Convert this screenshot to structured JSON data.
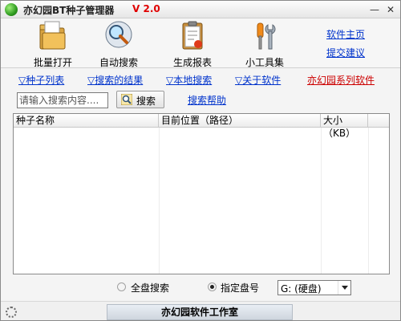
{
  "window": {
    "title": "亦幻园BT种子管理器",
    "version": "V 2.0",
    "minimize_glyph": "—",
    "close_glyph": "✕"
  },
  "toolbar": {
    "items": [
      {
        "label": "批量打开",
        "icon": "folder-icon"
      },
      {
        "label": "自动搜索",
        "icon": "magnifier-icon"
      },
      {
        "label": "生成报表",
        "icon": "clipboard-icon"
      },
      {
        "label": "小工具集",
        "icon": "tools-icon"
      }
    ]
  },
  "links": {
    "home": "软件主页",
    "suggest": "提交建议"
  },
  "tabs": [
    {
      "label": "▽种子列表"
    },
    {
      "label": "▽搜索的结果"
    },
    {
      "label": "▽本地搜索"
    },
    {
      "label": "▽关于软件"
    },
    {
      "label": "亦幻园系列软件"
    }
  ],
  "search": {
    "placeholder": "请输入搜索内容....",
    "button_label": "搜索",
    "help_label": "搜索帮助"
  },
  "list": {
    "columns": [
      "种子名称",
      "目前位置（路径）",
      "大小（KB）"
    ],
    "rows": []
  },
  "options": {
    "full_disk_label": "全盘搜索",
    "specified_disk_label": "指定盘号",
    "selected_mode": "指定盘号",
    "drive_value": "G: (硬盘)"
  },
  "status": {
    "studio": "亦幻园软件工作室"
  },
  "colors": {
    "link": "#0033cc",
    "highlight_link": "#cc0000",
    "version": "#e00000"
  }
}
